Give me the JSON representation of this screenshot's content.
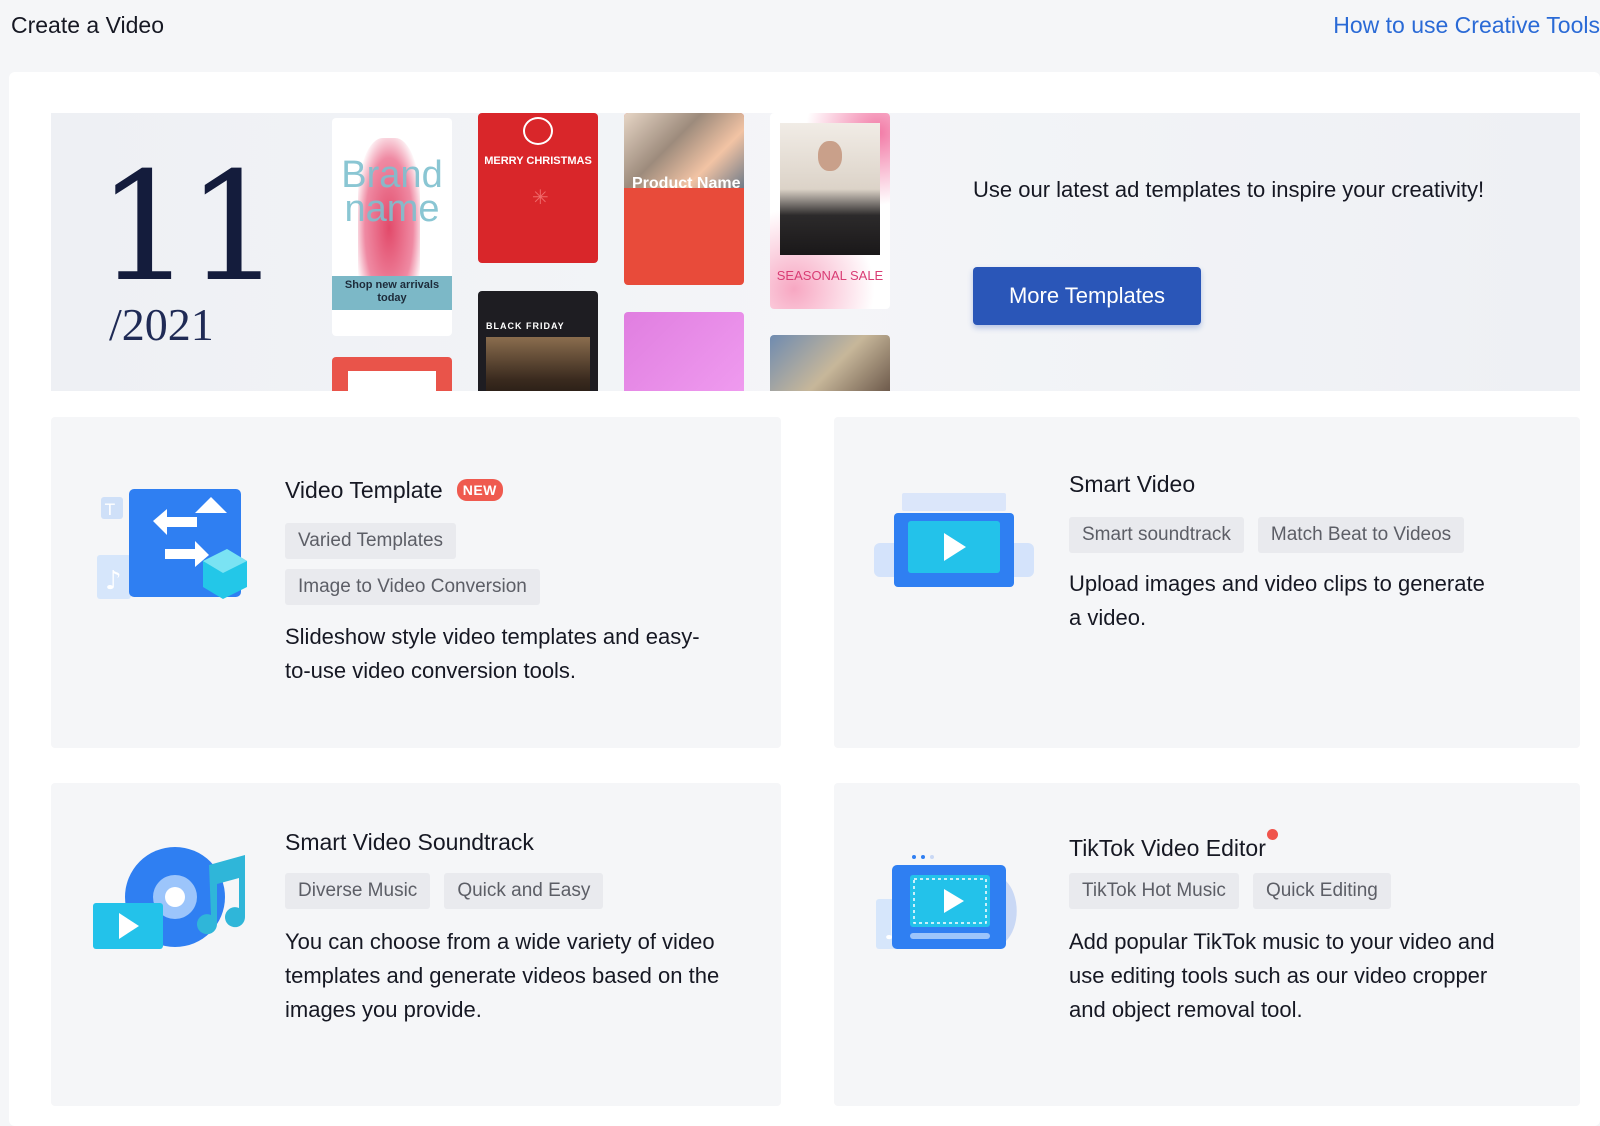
{
  "header": {
    "title": "Create a Video",
    "help_link": "How to use Creative Tools"
  },
  "banner": {
    "date_big": "11",
    "date_year": "/2021",
    "thumbnails": {
      "brand_name": "Brand name",
      "shop_text": "Shop new arrivals today",
      "christmas_text": "MERRY CHRISTMAS",
      "product_name": "Product Name",
      "seasonal_sale": "SEASONAL SALE",
      "black_friday": "BLACK FRIDAY"
    },
    "text": "Use our latest ad templates to inspire your creativity!",
    "button_label": "More Templates"
  },
  "cards": [
    {
      "title": "Video Template",
      "badge": "NEW",
      "tags": [
        "Varied Templates",
        "Image to Video Conversion"
      ],
      "description": "Slideshow style video templates and easy-to-use video conversion tools.",
      "icon": "video-template-icon"
    },
    {
      "title": "Smart Video",
      "tags": [
        "Smart soundtrack",
        "Match Beat to Videos"
      ],
      "description": "Upload images and video clips to generate a video.",
      "icon": "smart-video-icon"
    },
    {
      "title": "Smart Video Soundtrack",
      "tags": [
        "Diverse Music",
        "Quick and Easy"
      ],
      "description": "You can choose from a wide variety of video templates and generate videos based on the images you provide.",
      "icon": "soundtrack-icon"
    },
    {
      "title": "TikTok Video Editor",
      "tags": [
        "TikTok Hot Music",
        "Quick Editing"
      ],
      "description": "Add popular TikTok music to your video and use editing tools such as our video cropper and object removal tool.",
      "icon": "video-editor-icon"
    }
  ],
  "colors": {
    "accent": "#2a56b8",
    "link": "#2a6ad6",
    "badge": "#ef5a4f"
  }
}
